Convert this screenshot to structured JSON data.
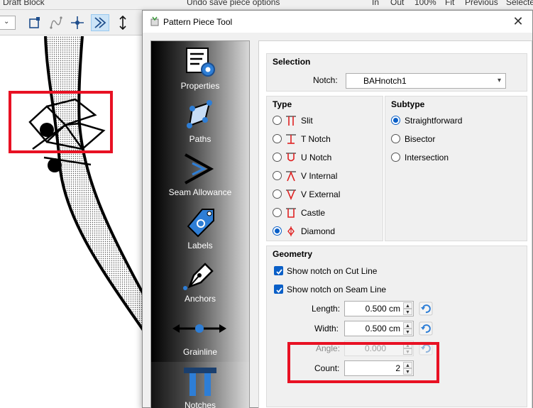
{
  "background": {
    "menu_left": "Draft Block",
    "menu_center": "Undo save piece options",
    "menu_right_items": [
      "In",
      "Out",
      "100%",
      "Fit",
      "Previous",
      "Selecte"
    ],
    "combo_arrow": "⌄"
  },
  "dialog": {
    "title": "Pattern Piece Tool",
    "close_glyph": "✕",
    "sidebar": [
      {
        "label": "Properties"
      },
      {
        "label": "Paths"
      },
      {
        "label": "Seam Allowance"
      },
      {
        "label": "Labels"
      },
      {
        "label": "Anchors"
      },
      {
        "label": "Grainline"
      },
      {
        "label": "Notches"
      }
    ],
    "selection": {
      "title": "Selection",
      "notch_label": "Notch:",
      "notch_value": "BAHnotch1"
    },
    "type": {
      "title": "Type",
      "options": [
        {
          "label": "Slit",
          "checked": false
        },
        {
          "label": "T Notch",
          "checked": false
        },
        {
          "label": "U Notch",
          "checked": false
        },
        {
          "label": "V Internal",
          "checked": false
        },
        {
          "label": "V External",
          "checked": false
        },
        {
          "label": "Castle",
          "checked": false
        },
        {
          "label": "Diamond",
          "checked": true
        }
      ]
    },
    "subtype": {
      "title": "Subtype",
      "options": [
        {
          "label": "Straightforward",
          "checked": true
        },
        {
          "label": "Bisector",
          "checked": false
        },
        {
          "label": "Intersection",
          "checked": false
        }
      ]
    },
    "geometry": {
      "title": "Geometry",
      "show_cut": "Show notch on Cut Line",
      "show_seam": "Show notch on Seam Line",
      "length_label": "Length:",
      "length_value": "0.500 cm",
      "width_label": "Width:",
      "width_value": "0.500 cm",
      "angle_label": "Angle:",
      "angle_value": "0.000",
      "count_label": "Count:",
      "count_value": "2"
    },
    "colors": {
      "accent": "#0a5fc7",
      "notch_red": "#e02020",
      "highlight": "#e81123"
    }
  }
}
